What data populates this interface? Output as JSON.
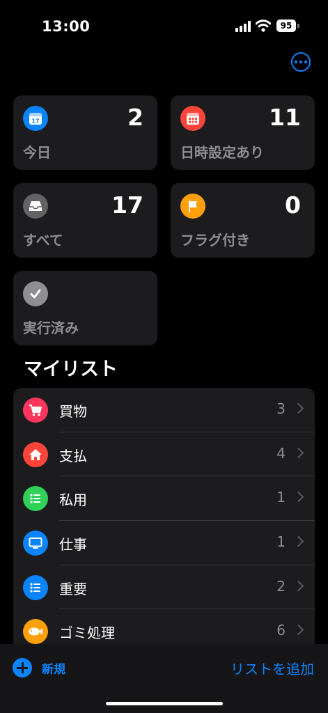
{
  "status_bar": {
    "time": "13:00",
    "battery": "95"
  },
  "tiles": [
    {
      "key": "today",
      "label": "今日",
      "count": "2",
      "icon": "calendar-icon",
      "color": "#0a84ff",
      "icon_text": "17"
    },
    {
      "key": "scheduled",
      "label": "日時設定あり",
      "count": "11",
      "icon": "calendar-grid-icon",
      "color": "#ff453a"
    },
    {
      "key": "all",
      "label": "すべて",
      "count": "17",
      "icon": "tray-icon",
      "color": "#636366"
    },
    {
      "key": "flagged",
      "label": "フラグ付き",
      "count": "0",
      "icon": "flag-icon",
      "color": "#ff9f0a"
    },
    {
      "key": "completed",
      "label": "実行済み",
      "icon": "checkmark-icon",
      "color": "#8e8e93"
    }
  ],
  "my_lists_title": "マイリスト",
  "lists": [
    {
      "name": "買物",
      "count": "3",
      "icon": "cart-icon",
      "color": "#ff375f"
    },
    {
      "name": "支払",
      "count": "4",
      "icon": "house-icon",
      "color": "#ff453a"
    },
    {
      "name": "私用",
      "count": "1",
      "icon": "list-bullet-icon",
      "color": "#30d158"
    },
    {
      "name": "仕事",
      "count": "1",
      "icon": "monitor-icon",
      "color": "#0a84ff"
    },
    {
      "name": "重要",
      "count": "2",
      "icon": "list-bullet-icon",
      "color": "#0a84ff"
    },
    {
      "name": "ゴミ処理",
      "count": "6",
      "icon": "fish-icon",
      "color": "#ff9f0a"
    }
  ],
  "bottom_bar": {
    "new_label": "新規",
    "add_list_label": "リストを追加"
  }
}
